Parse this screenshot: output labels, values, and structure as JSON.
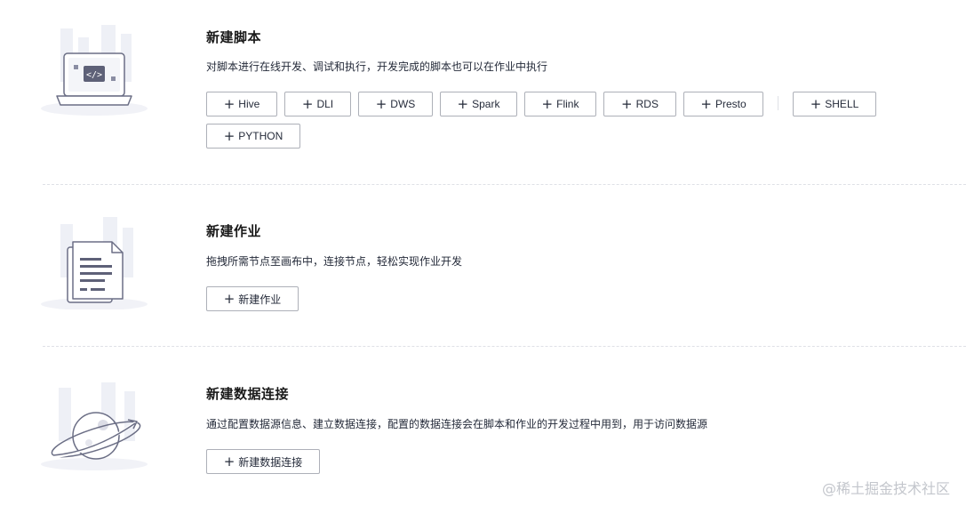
{
  "sections": [
    {
      "title": "新建脚本",
      "description": "对脚本进行在线开发、调试和执行，开发完成的脚本也可以在作业中执行",
      "buttons": [
        "Hive",
        "DLI",
        "DWS",
        "Spark",
        "Flink",
        "RDS",
        "Presto",
        "SHELL",
        "PYTHON"
      ]
    },
    {
      "title": "新建作业",
      "description": "拖拽所需节点至画布中，连接节点，轻松实现作业开发",
      "buttons": [
        "新建作业"
      ]
    },
    {
      "title": "新建数据连接",
      "description": "通过配置数据源信息、建立数据连接，配置的数据连接会在脚本和作业的开发过程中用到，用于访问数据源",
      "buttons": [
        "新建数据连接"
      ]
    }
  ],
  "watermark": "@稀土掘金技术社区",
  "icons": {
    "script": "laptop-code-icon",
    "job": "document-stack-icon",
    "connection": "planet-icon",
    "add": "plus-icon"
  },
  "colors": {
    "border": "#adb0b8",
    "text": "#252b3a",
    "divider": "#dfe1e6",
    "illustration": "#6b6e85"
  }
}
